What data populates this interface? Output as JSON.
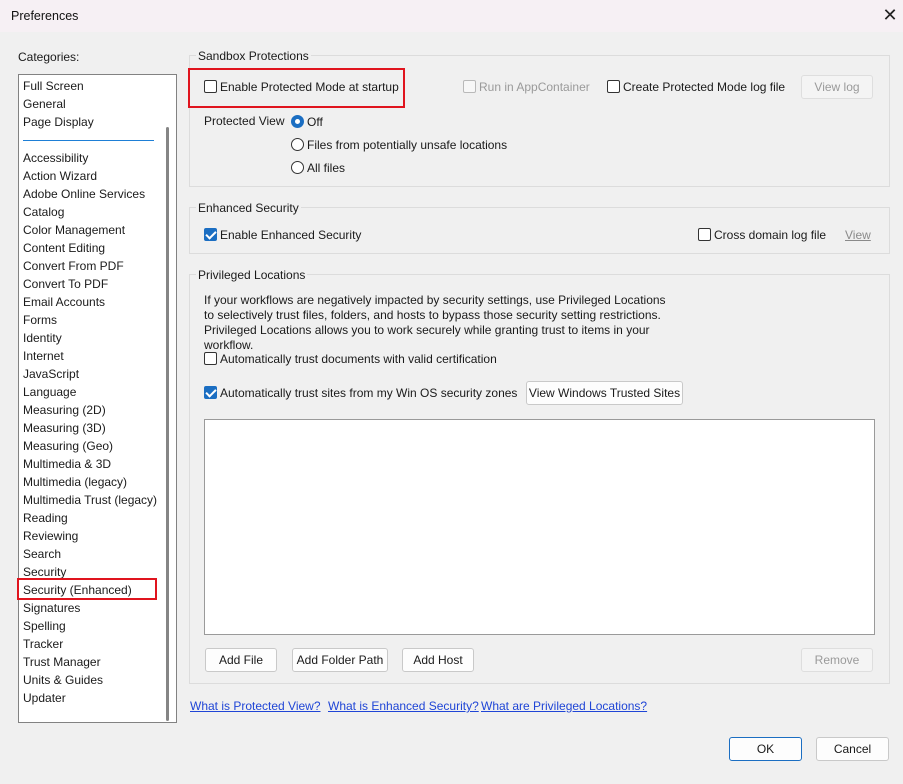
{
  "window": {
    "title": "Preferences",
    "close_glyph": "✕"
  },
  "categories": {
    "label": "Categories:",
    "top_items": [
      "Full Screen",
      "General",
      "Page Display"
    ],
    "items": [
      "Accessibility",
      "Action Wizard",
      "Adobe Online Services",
      "Catalog",
      "Color Management",
      "Content Editing",
      "Convert From PDF",
      "Convert To PDF",
      "Email Accounts",
      "Forms",
      "Identity",
      "Internet",
      "JavaScript",
      "Language",
      "Measuring (2D)",
      "Measuring (3D)",
      "Measuring (Geo)",
      "Multimedia & 3D",
      "Multimedia (legacy)",
      "Multimedia Trust (legacy)",
      "Reading",
      "Reviewing",
      "Search",
      "Security",
      "Security (Enhanced)",
      "Signatures",
      "Spelling",
      "Tracker",
      "Trust Manager",
      "Units & Guides",
      "Updater"
    ],
    "selected": "Security (Enhanced)"
  },
  "sandbox": {
    "title": "Sandbox Protections",
    "enable_protected_mode": {
      "label": "Enable Protected Mode at startup",
      "checked": false
    },
    "run_in_appcontainer": {
      "label": "Run in AppContainer",
      "checked": false,
      "enabled": false
    },
    "create_log": {
      "label": "Create Protected Mode log file",
      "checked": false
    },
    "view_log": "View log",
    "protected_view": {
      "label": "Protected View",
      "options": [
        "Off",
        "Files from potentially unsafe locations",
        "All files"
      ],
      "selected": "Off"
    }
  },
  "enhanced": {
    "title": "Enhanced Security",
    "enable_enhanced": {
      "label": "Enable Enhanced Security",
      "checked": true
    },
    "cross_domain": {
      "label": "Cross domain log file",
      "checked": false
    },
    "view": "View"
  },
  "privileged": {
    "title": "Privileged Locations",
    "description": "If your workflows are negatively impacted by security settings, use Privileged Locations to selectively trust files, folders, and hosts to bypass those security setting restrictions. Privileged Locations allows you to work securely while granting trust to items in your workflow.",
    "trust_certified": {
      "label": "Automatically trust documents with valid certification",
      "checked": false
    },
    "trust_os_zones": {
      "label": "Automatically trust sites from my Win OS security zones",
      "checked": true
    },
    "view_trusted_sites": "View Windows Trusted Sites",
    "buttons": {
      "add_file": "Add File",
      "add_folder": "Add Folder Path",
      "add_host": "Add Host",
      "remove": "Remove"
    }
  },
  "links": [
    "What is Protected View?",
    "What is Enhanced Security?",
    "What are Privileged Locations?"
  ],
  "footer": {
    "ok": "OK",
    "cancel": "Cancel"
  },
  "colors": {
    "highlight_box": "#e0141e",
    "accent": "#1b6ec2",
    "link": "#1f45d6"
  }
}
